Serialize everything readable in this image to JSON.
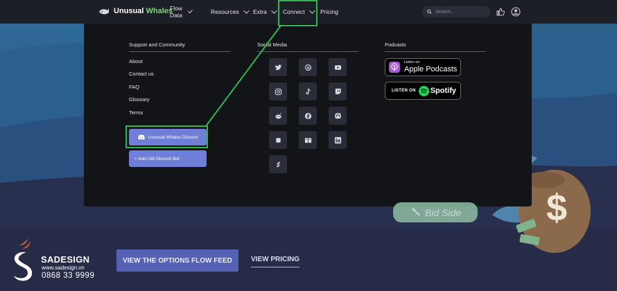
{
  "brand": {
    "name_part1": "Unusual",
    "name_part2": "Whales"
  },
  "nav": {
    "items": [
      {
        "label": "Flow Data",
        "has_dropdown": true
      },
      {
        "label": "Resources",
        "has_dropdown": true
      },
      {
        "label": "Extra",
        "has_dropdown": true
      },
      {
        "label": "Connect",
        "has_dropdown": true
      },
      {
        "label": "Pricing",
        "has_dropdown": false
      }
    ],
    "search_placeholder": "Search..."
  },
  "dropdown": {
    "support": {
      "title": "Support and Community",
      "links": [
        "About",
        "Contact us",
        "FAQ",
        "Glossary",
        "Terms"
      ],
      "discord_button": "Unusual Whales Discord",
      "bot_button": "+ Add UW Discord Bot"
    },
    "social": {
      "title": "Social Media",
      "icons": [
        "twitter-icon",
        "threads-icon",
        "youtube-icon",
        "instagram-icon",
        "tiktok-icon",
        "twitch-icon",
        "reddit-icon",
        "facebook-icon",
        "mastodon-icon",
        "substack-icon",
        "book-icon",
        "linkedin-icon",
        "stocktwits-icon"
      ]
    },
    "podcasts": {
      "title": "Podcasts",
      "apple_small": "Listen on",
      "apple_big": "Apple Podcasts",
      "spotify_small": "LISTEN ON",
      "spotify_big": "Spotify"
    }
  },
  "hero": {
    "bid_side": "Bid Side",
    "cta": "VIEW THE OPTIONS FLOW FEED",
    "pricing_link": "VIEW PRICING"
  },
  "watermark": {
    "name": "SADESIGN",
    "website": "www.sadesign.vn",
    "phone": "0868 33 9999"
  },
  "colors": {
    "accent_green": "#2eb84f",
    "discord_blue": "#6f7fd8",
    "cta_blue": "#5561b3"
  }
}
